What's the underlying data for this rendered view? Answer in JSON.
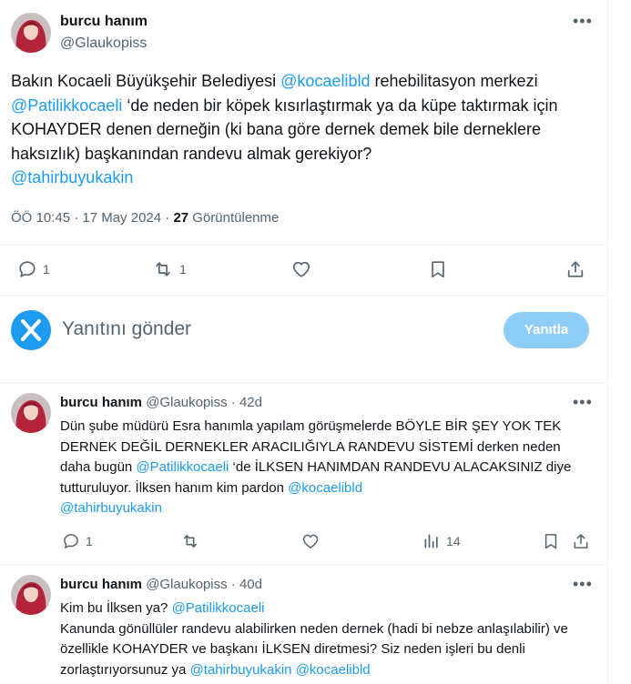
{
  "main_tweet": {
    "display_name": "burcu hanım",
    "handle": "@Glaukopiss",
    "text_parts": [
      {
        "t": "Bakın Kocaeli Büyükşehir Belediyesi ",
        "m": false
      },
      {
        "t": "@kocaelibld",
        "m": true
      },
      {
        "t": " rehebilitasyon merkezi\n",
        "m": false
      },
      {
        "t": "@Patilikkocaeli",
        "m": true
      },
      {
        "t": " ‘de neden bir köpek kısırlaştırmak ya da küpe taktırmak için KOHAYDER denen derneğin (ki bana göre dernek demek bile derneklere haksızlık) başkanından randevu almak gerekiyor?\n",
        "m": false
      },
      {
        "t": "@tahirbuyukakin",
        "m": true
      }
    ],
    "time": "ÖÖ 10:45 · 17 May 2024 · ",
    "views_count": "27",
    "views_label": " Görüntülenme",
    "reply_count": "1",
    "retweet_count": "1"
  },
  "reply_box": {
    "placeholder": "Yanıtını gönder",
    "button_label": "Yanıtla"
  },
  "replies": [
    {
      "display_name": "burcu hanım",
      "handle": "@Glaukopiss",
      "age": "· 42d",
      "text_parts": [
        {
          "t": "Dün şube müdürü Esra hanımla yapılam görüşmelerde BÖYLE BİR ŞEY YOK TEK DERNEK DEĞİL DERNEKLER ARACILIĞIYLA RANDEVU SİSTEMİ derken neden daha bugün ",
          "m": false
        },
        {
          "t": "@Patilikkocaeli",
          "m": true
        },
        {
          "t": " ‘de İLKSEN HANIMDAN RANDEVU ALACAKSINIZ diye tutturuluyor. İlksen hanım kim pardon ",
          "m": false
        },
        {
          "t": "@kocaelibld",
          "m": true
        },
        {
          "t": "\n",
          "m": false
        },
        {
          "t": "@tahirbuyukakin",
          "m": true
        }
      ],
      "reply_count": "1",
      "views_count": "14"
    },
    {
      "display_name": "burcu hanım",
      "handle": "@Glaukopiss",
      "age": "· 40d",
      "text_parts": [
        {
          "t": "Kim bu İlksen ya? ",
          "m": false
        },
        {
          "t": "@Patilikkocaeli",
          "m": true
        },
        {
          "t": "\nKanunda gönüllüler randevu alabilirken neden dernek (hadi bi nebze anlaşılabilir) ve özellikle KOHAYDER ve başkanı İLKSEN diretmesi? Siz neden işleri bu denli zorlaştırıyorsunuz ya ",
          "m": false
        },
        {
          "t": "@tahirbuyukakin",
          "m": true
        },
        {
          "t": " ",
          "m": false
        },
        {
          "t": "@kocaelibld",
          "m": true
        }
      ]
    }
  ],
  "colors": {
    "accent": "#1d9bf0",
    "button_disabled": "#8ecdf8",
    "muted": "#536471"
  }
}
